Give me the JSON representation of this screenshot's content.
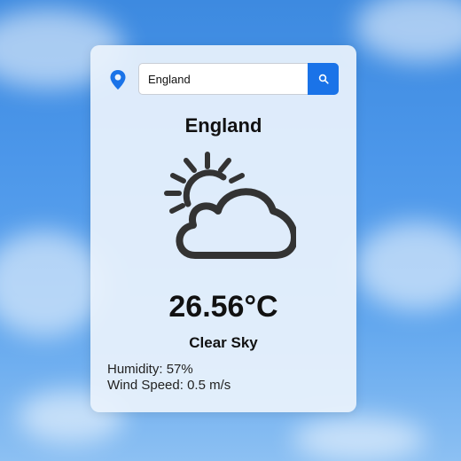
{
  "search": {
    "value": "England",
    "placeholder": ""
  },
  "location": {
    "city": "England"
  },
  "weather": {
    "temperature": "26.56°C",
    "description": "Clear Sky",
    "icon": "sun-behind-cloud-icon"
  },
  "details": {
    "humidity_label": "Humidity:",
    "humidity_value": "57%",
    "wind_label": "Wind Speed:",
    "wind_value": "0.5 m/s"
  },
  "icons": {
    "location": "location-pin-icon",
    "search": "search-icon"
  },
  "colors": {
    "accent": "#1a73e8",
    "icon_dark": "#333333",
    "card": "#eaf2fc"
  }
}
